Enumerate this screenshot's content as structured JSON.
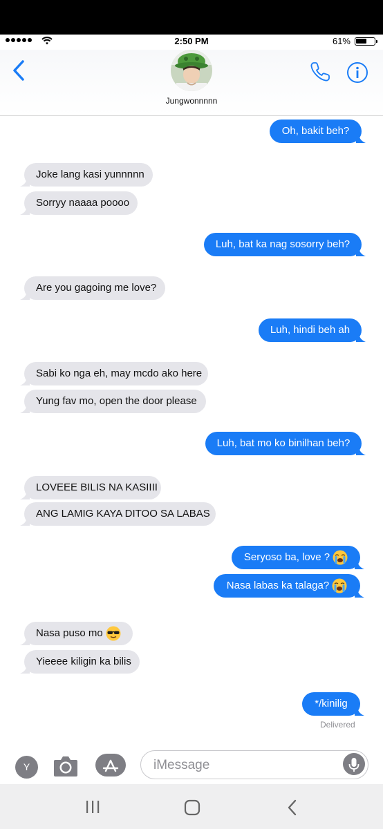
{
  "status": {
    "time": "2:50 PM",
    "battery": "61%",
    "battery_level": 0.61
  },
  "header": {
    "contact_name": "Jungwonnnnn"
  },
  "messages": [
    {
      "dir": "out",
      "text": "Oh, bakit beh?"
    },
    {
      "dir": "in",
      "text": "Joke lang kasi yunnnnn"
    },
    {
      "dir": "in",
      "text": "Sorryy naaaa poooo"
    },
    {
      "dir": "out",
      "text": "Luh, bat ka nag sosorry beh?"
    },
    {
      "dir": "in",
      "text": "Are you gagoing me love?"
    },
    {
      "dir": "out",
      "text": "Luh, hindi beh ah"
    },
    {
      "dir": "in",
      "text": "Sabi ko nga eh, may mcdo ako here"
    },
    {
      "dir": "in",
      "text": "Yung fav mo, open the door please"
    },
    {
      "dir": "out",
      "text": "Luh, bat mo ko binilhan beh?"
    },
    {
      "dir": "in",
      "text": "LOVEEE BILIS NA KASIIII"
    },
    {
      "dir": "in",
      "text": "ANG LAMIG KAYA DITOO SA LABAS"
    },
    {
      "dir": "out",
      "text": "Seryoso ba, love ?",
      "emoji": "loudly-crying-face"
    },
    {
      "dir": "out",
      "text": "Nasa labas ka talaga?",
      "emoji": "loudly-crying-face"
    },
    {
      "dir": "in",
      "text": "Nasa puso mo",
      "emoji": "sunglasses-face"
    },
    {
      "dir": "in",
      "text": "Yieeee kiligin ka bilis"
    },
    {
      "dir": "out",
      "text": "*/kinilig"
    }
  ],
  "delivered_label": "Delivered",
  "composer": {
    "placeholder": "iMessage",
    "app_letter": "Y"
  },
  "colors": {
    "outgoing": "#1a7cf6",
    "incoming": "#e5e5ea",
    "accent": "#1a7cf6"
  }
}
